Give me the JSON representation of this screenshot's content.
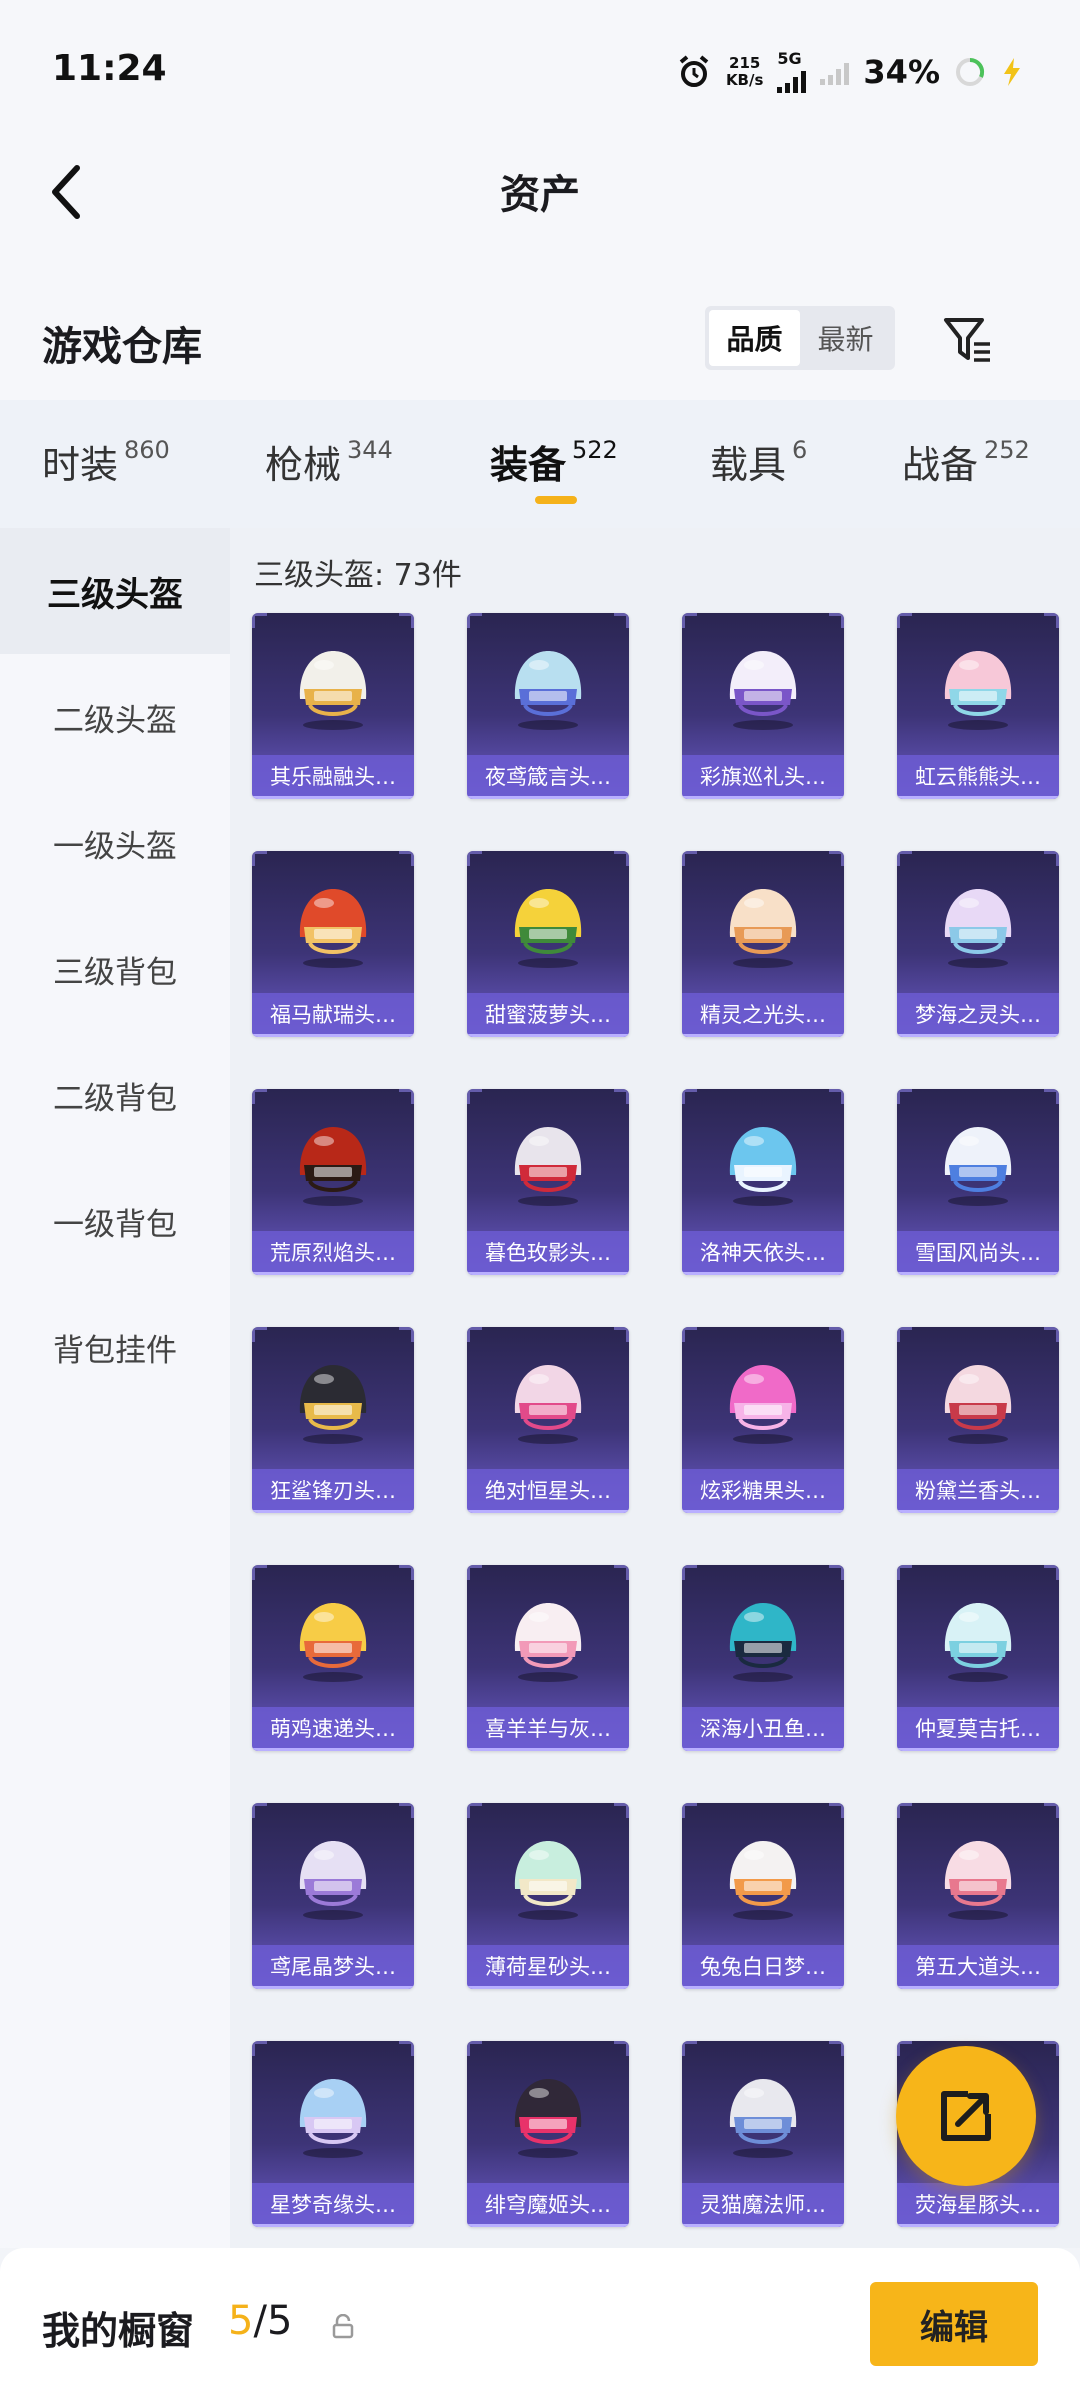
{
  "status_bar": {
    "time": "11:24",
    "net_speed_value": "215",
    "net_speed_unit": "KB/s",
    "network": "5G",
    "battery": "34%"
  },
  "header": {
    "title": "资产",
    "back_icon": "chevron-left-icon"
  },
  "warehouse": {
    "title": "游戏仓库",
    "sort_options": [
      "品质",
      "最新"
    ],
    "sort_selected": "品质",
    "filter_icon": "filter-icon"
  },
  "tabs": [
    {
      "label": "时装",
      "count": "860"
    },
    {
      "label": "枪械",
      "count": "344"
    },
    {
      "label": "装备",
      "count": "522",
      "active": true
    },
    {
      "label": "载具",
      "count": "6"
    },
    {
      "label": "战备",
      "count": "252"
    }
  ],
  "sidebar": {
    "items": [
      "三级头盔",
      "二级头盔",
      "一级头盔",
      "三级背包",
      "二级背包",
      "一级背包",
      "背包挂件"
    ],
    "active": "三级头盔"
  },
  "section_label": "三级头盔: 73件",
  "items": [
    {
      "name": "其乐融融头…",
      "color": "#f2f0ea",
      "accent": "#e8b24a"
    },
    {
      "name": "夜鸢箴言头…",
      "color": "#b8dff0",
      "accent": "#5a6fd8"
    },
    {
      "name": "彩旗巡礼头…",
      "color": "#f3eefa",
      "accent": "#7a56c8"
    },
    {
      "name": "虹云熊熊头…",
      "color": "#f7c8d8",
      "accent": "#8fd7e8"
    },
    {
      "name": "福马献瑞头…",
      "color": "#e04a2a",
      "accent": "#f2c265"
    },
    {
      "name": "甜蜜菠萝头…",
      "color": "#f5d23a",
      "accent": "#3f8a3a"
    },
    {
      "name": "精灵之光头…",
      "color": "#f8e0c8",
      "accent": "#e89a56"
    },
    {
      "name": "梦海之灵头…",
      "color": "#e8d9f6",
      "accent": "#8cc9e8"
    },
    {
      "name": "荒原烈焰头…",
      "color": "#b82818",
      "accent": "#2b1a14"
    },
    {
      "name": "暮色玫影头…",
      "color": "#e8e4ec",
      "accent": "#d02a3a"
    },
    {
      "name": "洛神天依头…",
      "color": "#6cc6ee",
      "accent": "#e9f4ff"
    },
    {
      "name": "雪国风尚头…",
      "color": "#eef2fa",
      "accent": "#4e7fe0"
    },
    {
      "name": "狂鲨锋刃头…",
      "color": "#2b2b33",
      "accent": "#e8ba4a"
    },
    {
      "name": "绝对恒星头…",
      "color": "#f2d6e6",
      "accent": "#e24a8a"
    },
    {
      "name": "炫彩糖果头…",
      "color": "#f06ac8",
      "accent": "#f7b3e8"
    },
    {
      "name": "粉黛兰香头…",
      "color": "#f4d8e0",
      "accent": "#c83a4a"
    },
    {
      "name": "萌鸡速递头…",
      "color": "#f7cc46",
      "accent": "#e86a3a"
    },
    {
      "name": "喜羊羊与灰…",
      "color": "#f8eef2",
      "accent": "#f29ab8"
    },
    {
      "name": "深海小丑鱼…",
      "color": "#2fb6c8",
      "accent": "#1a2a40"
    },
    {
      "name": "仲夏莫吉托…",
      "color": "#d8f2f6",
      "accent": "#7cd0e0"
    },
    {
      "name": "鸢尾晶梦头…",
      "color": "#e6e0f4",
      "accent": "#9b7ad8"
    },
    {
      "name": "薄荷星砂头…",
      "color": "#c8eede",
      "accent": "#f2e8c8"
    },
    {
      "name": "兔兔白日梦…",
      "color": "#f4f2f2",
      "accent": "#f29a4a"
    },
    {
      "name": "第五大道头…",
      "color": "#f8dce4",
      "accent": "#e8788e"
    },
    {
      "name": "星梦奇缘头…",
      "color": "#a8d0f4",
      "accent": "#d8c8f4"
    },
    {
      "name": "绯穹魔姬头…",
      "color": "#302838",
      "accent": "#e8326a"
    },
    {
      "name": "灵猫魔法师…",
      "color": "#e8e8ee",
      "accent": "#6e8ed8"
    },
    {
      "name": "荧海星豚头…",
      "color": "#8ecaf0",
      "accent": "#f4e6a8"
    }
  ],
  "fab": {
    "icon": "share-external-icon"
  },
  "bottom_bar": {
    "label": "我的橱窗",
    "current": "5",
    "separator": "/",
    "total": "5",
    "lock_icon": "lock-icon",
    "edit_label": "编辑"
  }
}
